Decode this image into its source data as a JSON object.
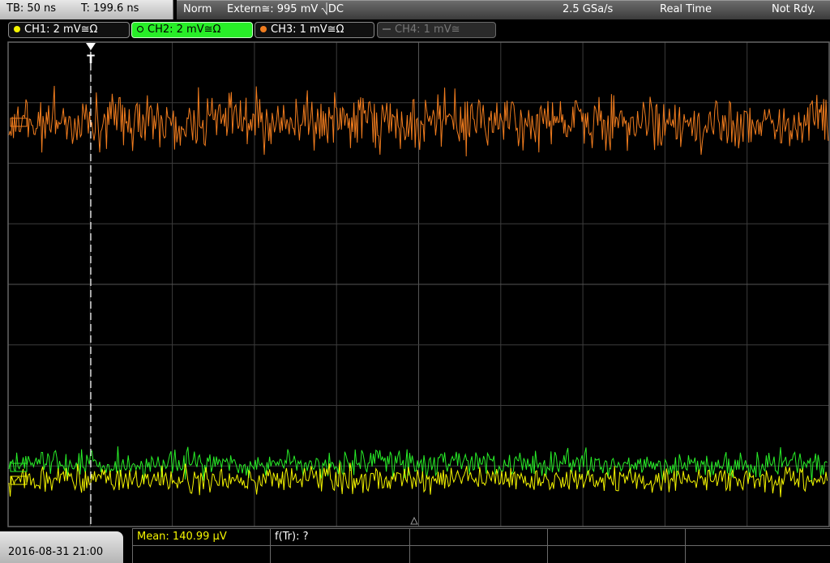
{
  "top": {
    "timebase": "TB: 50 ns",
    "trigger_time": "T: 199.6 ns",
    "trigger_mode": "Norm",
    "trigger_source": "Extern≅: 995 mV ⎷DC",
    "sample_rate": "2.5 GSa/s",
    "acq_mode": "Real Time",
    "status": "Not Rdy."
  },
  "channels": [
    {
      "label": "CH1: 2 mV≅Ω",
      "color": "#f5f500",
      "active": false
    },
    {
      "label": "CH2: 2 mV≅Ω",
      "color": "#28ee28",
      "active": true
    },
    {
      "label": "CH3: 1 mV≅Ω",
      "color": "#f07c1e",
      "active": false
    },
    {
      "label": "CH4: 1 mV≅",
      "color": "#666666",
      "active": false
    }
  ],
  "waveforms": {
    "ch3_color": "#f07c1e",
    "ch2_color": "#28ee28",
    "ch1_color": "#f5f500",
    "grid_color": "#3c3c3c",
    "trigger_marker": "T"
  },
  "bottom": {
    "datetime": "2016-08-31 21:00",
    "measurement": "Mean: 140.99 µV",
    "ftr": "f(Tr): ?"
  }
}
